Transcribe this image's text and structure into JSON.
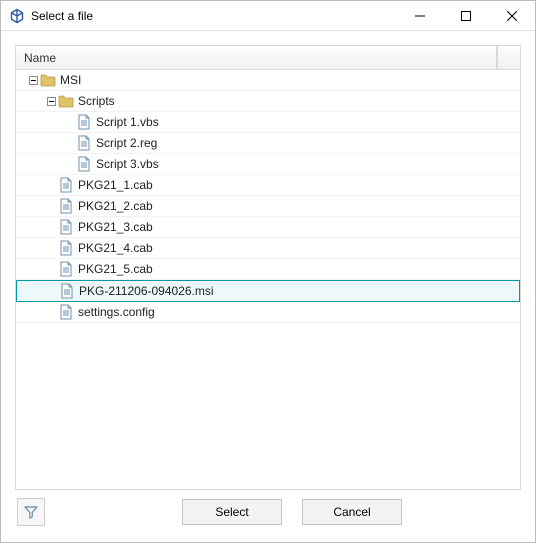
{
  "window": {
    "title": "Select a file"
  },
  "header": {
    "name_column": "Name"
  },
  "tree": [
    {
      "id": "msi",
      "indent": 0,
      "type": "folder",
      "expandable": true,
      "expanded": true,
      "label": "MSI",
      "selected": false
    },
    {
      "id": "scripts",
      "indent": 1,
      "type": "folder",
      "expandable": true,
      "expanded": true,
      "label": "Scripts",
      "selected": false
    },
    {
      "id": "s1",
      "indent": 2,
      "type": "file",
      "expandable": false,
      "label": "Script 1.vbs",
      "selected": false
    },
    {
      "id": "s2",
      "indent": 2,
      "type": "file",
      "expandable": false,
      "label": "Script 2.reg",
      "selected": false
    },
    {
      "id": "s3",
      "indent": 2,
      "type": "file",
      "expandable": false,
      "label": "Script 3.vbs",
      "selected": false
    },
    {
      "id": "p1",
      "indent": 1,
      "type": "file",
      "expandable": false,
      "label": "PKG21_1.cab",
      "selected": false
    },
    {
      "id": "p2",
      "indent": 1,
      "type": "file",
      "expandable": false,
      "label": "PKG21_2.cab",
      "selected": false
    },
    {
      "id": "p3",
      "indent": 1,
      "type": "file",
      "expandable": false,
      "label": "PKG21_3.cab",
      "selected": false
    },
    {
      "id": "p4",
      "indent": 1,
      "type": "file",
      "expandable": false,
      "label": "PKG21_4.cab",
      "selected": false
    },
    {
      "id": "p5",
      "indent": 1,
      "type": "file",
      "expandable": false,
      "label": "PKG21_5.cab",
      "selected": false
    },
    {
      "id": "pkg",
      "indent": 1,
      "type": "file",
      "expandable": false,
      "label": "PKG-211206-094026.msi",
      "selected": true
    },
    {
      "id": "set",
      "indent": 1,
      "type": "file",
      "expandable": false,
      "label": "settings.config",
      "selected": false
    }
  ],
  "buttons": {
    "select": "Select",
    "cancel": "Cancel"
  }
}
